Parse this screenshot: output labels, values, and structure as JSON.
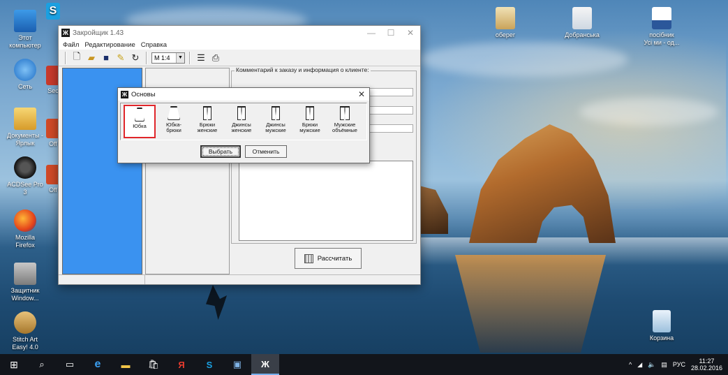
{
  "desktop": {
    "icons_left": [
      {
        "name": "this-pc",
        "label": "Этот\nкомпьютер"
      },
      {
        "name": "network",
        "label": "Сеть"
      },
      {
        "name": "documents-shortcut",
        "label": "Документы -\nЯрлык"
      },
      {
        "name": "acdsee",
        "label": "ACDSee Pro\n3"
      },
      {
        "name": "firefox",
        "label": "Mozilla\nFirefox"
      },
      {
        "name": "windows-defender",
        "label": "Защитник\nWindow..."
      },
      {
        "name": "stitch-art",
        "label": "Stitch Art\nEasy! 4.0"
      }
    ],
    "icons_partial": [
      "Sec",
      "Off",
      "Off"
    ],
    "icons_right": [
      {
        "name": "obereg",
        "label": "оберег"
      },
      {
        "name": "dobranska",
        "label": "Добранська"
      },
      {
        "name": "posibnyk",
        "label": "посібник\nУсі ми - од..."
      },
      {
        "name": "recycle-bin",
        "label": "Корзина"
      }
    ]
  },
  "app": {
    "title": "Закройщик 1.43",
    "menu": [
      "Файл",
      "Редактирование",
      "Справка"
    ],
    "scale": "M 1:4",
    "comment_legend": "Комментарий к заказу и информация о клиенте:",
    "calc_button": "Рассчитать"
  },
  "dialog": {
    "title": "Основы",
    "bases": [
      {
        "label": "Юбка",
        "kind": "skirt"
      },
      {
        "label": "Юбка-\nбрюки",
        "kind": "skirt"
      },
      {
        "label": "Брюки\nженские",
        "kind": "pants"
      },
      {
        "label": "Джинсы\nженские",
        "kind": "pants"
      },
      {
        "label": "Джинсы\nмужские",
        "kind": "pants"
      },
      {
        "label": "Брюки\nмужские",
        "kind": "pants"
      },
      {
        "label": "Мужские\nобъёмные",
        "kind": "pants"
      }
    ],
    "selected_index": 0,
    "select_button": "Выбрать",
    "cancel_button": "Отменить"
  },
  "taskbar": {
    "language": "РУС",
    "time": "11:27",
    "date": "28.02.2016"
  }
}
